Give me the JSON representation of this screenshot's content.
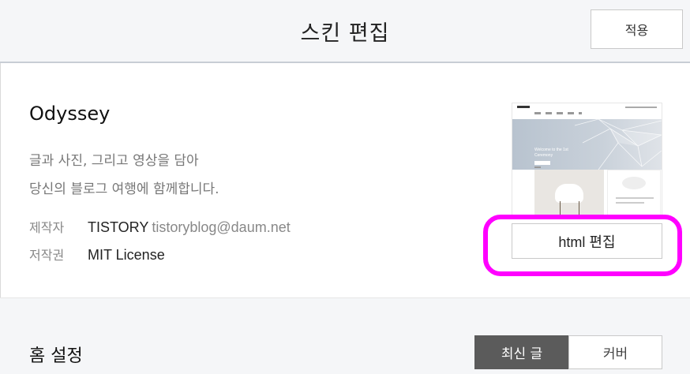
{
  "header": {
    "title": "스킨 편집",
    "apply_label": "적용"
  },
  "skin": {
    "name": "Odyssey",
    "description_lines": [
      "글과 사진, 그리고 영상을 담아",
      "당신의 블로그 여행에 함께합니다."
    ],
    "maker_label": "제작자",
    "maker_name": "TISTORY",
    "maker_email": "tistoryblog@daum.net",
    "license_label": "저작권",
    "license_value": "MIT License",
    "html_edit_label": "html 편집",
    "thumbnail": {
      "hero_text_1": "Welcome to the 1st",
      "hero_text_2": "Ceremony"
    }
  },
  "home": {
    "title": "홈 설정",
    "options": [
      "최신 글",
      "커버"
    ],
    "selected": "최신 글"
  },
  "colors": {
    "highlight": "#ff00ff",
    "selected_segment": "#5b5b5b",
    "header_bg": "#f5f6f8"
  }
}
